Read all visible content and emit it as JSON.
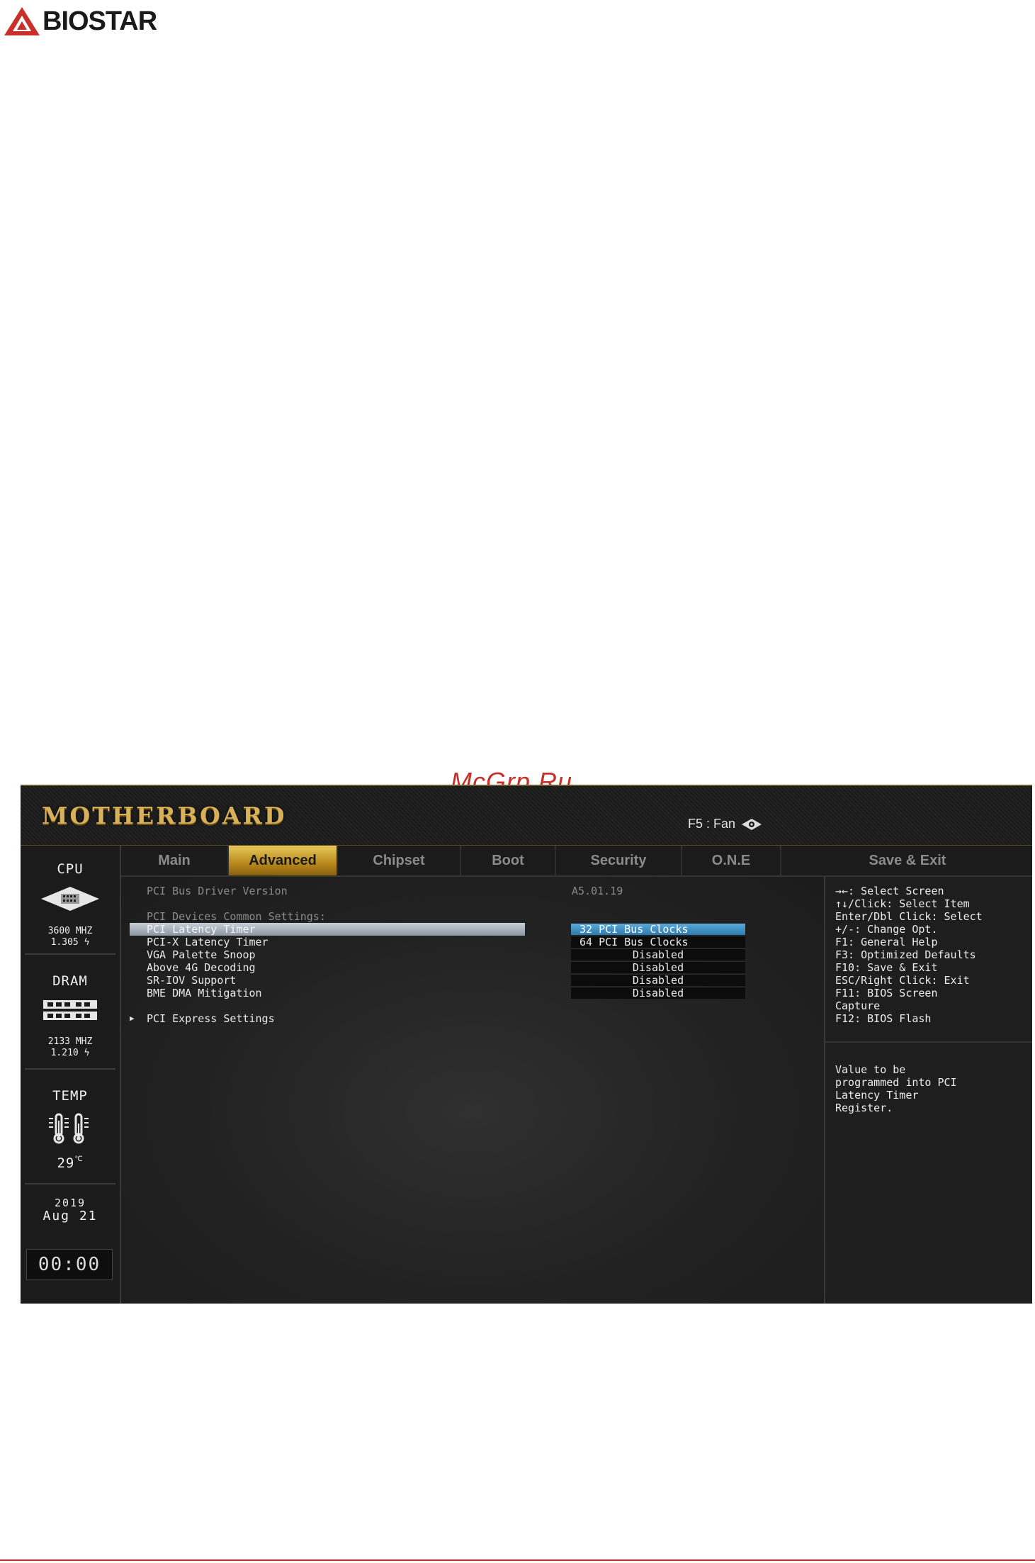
{
  "page": {
    "logo_text": "BIOSTAR",
    "watermark": "McGrp.Ru"
  },
  "bios": {
    "brand": "MOTHERBOARD",
    "fan_hotkey": "F5 : Fan",
    "sidebar": {
      "cpu": {
        "title": "CPU",
        "freq": "3600 MHZ",
        "volt": "1.305"
      },
      "dram": {
        "title": "DRAM",
        "freq": "2133 MHZ",
        "volt": "1.210"
      },
      "temp": {
        "title": "TEMP",
        "value": "29"
      },
      "date": {
        "year": "2019",
        "day": "Aug 21"
      },
      "clock": "00:00"
    },
    "tabs": [
      "Main",
      "Advanced",
      "Chipset",
      "Boot",
      "Security",
      "O.N.E",
      "Save & Exit"
    ],
    "active_tab": "Advanced",
    "main": {
      "driver_label": "PCI Bus Driver Version",
      "driver_value": "A5.01.19",
      "section_header": "PCI Devices Common Settings:",
      "settings": [
        {
          "label": "PCI Latency Timer",
          "value": "32 PCI Bus Clocks"
        },
        {
          "label": "PCI-X Latency Timer",
          "value": "64 PCI Bus Clocks"
        },
        {
          "label": "VGA Palette Snoop",
          "value": "Disabled"
        },
        {
          "label": "Above 4G Decoding",
          "value": "Disabled"
        },
        {
          "label": "SR-IOV Support",
          "value": "Disabled"
        },
        {
          "label": "BME DMA Mitigation",
          "value": "Disabled"
        }
      ],
      "submenu": "PCI Express Settings"
    },
    "help": {
      "keys": [
        "→←: Select Screen",
        "↑↓/Click: Select Item",
        "Enter/Dbl Click: Select",
        "+/-: Change Opt.",
        "F1: General Help",
        "F3: Optimized Defaults",
        "F10: Save & Exit",
        "ESC/Right Click: Exit",
        "F11: BIOS Screen",
        "Capture",
        "F12: BIOS Flash"
      ],
      "description": [
        "Value to be",
        "programmed into PCI",
        "Latency Timer",
        "Register."
      ]
    }
  }
}
